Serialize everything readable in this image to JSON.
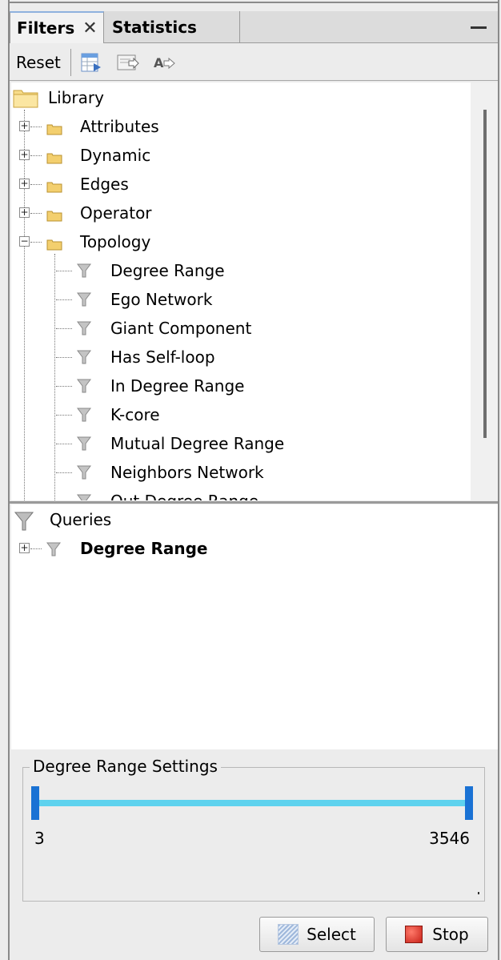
{
  "tabs": {
    "filters_label": "Filters",
    "statistics_label": "Statistics",
    "close_glyph": "✕"
  },
  "toolbar": {
    "reset_label": "Reset",
    "icons": [
      "export-table-icon",
      "export-icon",
      "rename-icon"
    ]
  },
  "library": {
    "root_label": "Library",
    "categories": [
      {
        "label": "Attributes",
        "expanded": false
      },
      {
        "label": "Dynamic",
        "expanded": false
      },
      {
        "label": "Edges",
        "expanded": false
      },
      {
        "label": "Operator",
        "expanded": false
      },
      {
        "label": "Topology",
        "expanded": true
      }
    ],
    "topology_filters": [
      "Degree Range",
      "Ego Network",
      "Giant Component",
      "Has Self-loop",
      "In Degree Range",
      "K-core",
      "Mutual Degree Range",
      "Neighbors Network",
      "Out Degree Range"
    ]
  },
  "queries": {
    "root_label": "Queries",
    "items": [
      "Degree Range"
    ]
  },
  "settings": {
    "title": "Degree Range Settings",
    "range_min": "3",
    "range_max": "3546",
    "accent_color": "#1a72d4",
    "track_color": "#5ed2ee"
  },
  "actions": {
    "select_label": "Select",
    "stop_label": "Stop"
  }
}
